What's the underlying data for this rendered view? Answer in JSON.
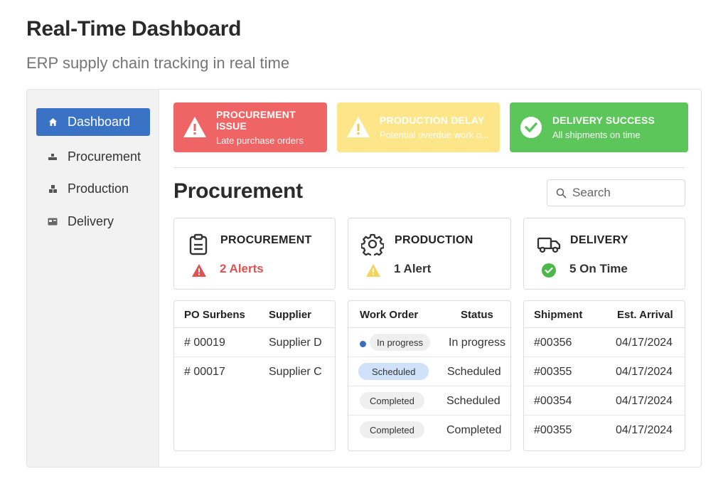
{
  "page": {
    "title": "Real-Time Dashboard",
    "subtitle": "ERP supply chain tracking in real time"
  },
  "sidebar": {
    "items": [
      {
        "label": "Dashboard",
        "icon": "home-icon",
        "active": true
      },
      {
        "label": "Procurement",
        "icon": "boxes-icon"
      },
      {
        "label": "Production",
        "icon": "blocks-icon"
      },
      {
        "label": "Delivery",
        "icon": "card-icon"
      }
    ]
  },
  "alerts": [
    {
      "title": "PROCUREMENT ISSUE",
      "subtitle": "Late purchase orders",
      "color": "#ef6464",
      "icon": "warning-icon"
    },
    {
      "title": "PRODUCTION DELAY",
      "subtitle": "Potential overdue work o...",
      "color": "#fde68a",
      "icon": "warning-icon"
    },
    {
      "title": "DELIVERY SUCCESS",
      "subtitle": "All shipments on time",
      "color": "#5cc65a",
      "icon": "check-circle-icon"
    }
  ],
  "section": {
    "title": "Procurement",
    "search_placeholder": "Search"
  },
  "summary": [
    {
      "title": "PROCUREMENT",
      "stat": "2 Alerts",
      "stat_color": "#e05252",
      "icon": "clipboard-icon",
      "stat_icon": "warning-icon"
    },
    {
      "title": "PRODUCTION",
      "stat": "1 Alert",
      "stat_color": "#333333",
      "icon": "gear-icon",
      "stat_icon": "warning-icon"
    },
    {
      "title": "DELIVERY",
      "stat": "5 On Time",
      "stat_color": "#333333",
      "icon": "truck-icon",
      "stat_icon": "check-circle-icon"
    }
  ],
  "tables": {
    "procurement": {
      "headers": [
        "PO Surbens",
        "Supplier"
      ],
      "rows": [
        [
          "# 00019",
          "Supplier D"
        ],
        [
          "# 00017",
          "Supplier C"
        ]
      ]
    },
    "production": {
      "headers": [
        "Work Order",
        "Status"
      ],
      "rows": [
        [
          "In progress",
          "In progress"
        ],
        [
          "Scheduled",
          "Scheduled"
        ],
        [
          "Completed",
          "Scheduled"
        ],
        [
          "Completed",
          "Completed"
        ]
      ]
    },
    "delivery": {
      "headers": [
        "Shipment",
        "Est. Arrival"
      ],
      "rows": [
        [
          "#00356",
          "04/17/2024"
        ],
        [
          "#00355",
          "04/17/2024"
        ],
        [
          "#00354",
          "04/17/2024"
        ],
        [
          "#00355",
          "04/17/2024"
        ]
      ]
    }
  },
  "colors": {
    "accent": "#3a72c6",
    "alert_red": "#ef6464",
    "alert_yellow": "#fde68a",
    "alert_green": "#5cc65a",
    "link": "#2e4f8c"
  }
}
